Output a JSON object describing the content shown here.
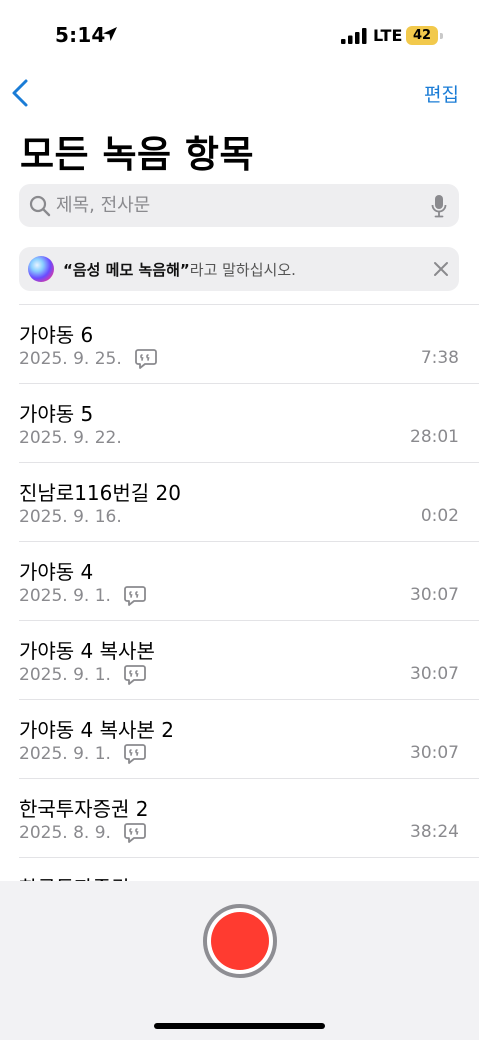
{
  "status_bar": {
    "time": "5:14",
    "carrier": "LTE",
    "battery": "42"
  },
  "nav": {
    "edit_label": "편집"
  },
  "page_title": "모든 녹음 항목",
  "search": {
    "placeholder": "제목, 전사문"
  },
  "siri_suggestion": {
    "quote": "“음성 메모 녹음해”",
    "text": "라고 말하십시오."
  },
  "recordings": [
    {
      "title": "가야동 6",
      "date": "2025. 9. 25.",
      "duration": "7:38",
      "has_transcript": true
    },
    {
      "title": "가야동 5",
      "date": "2025. 9. 22.",
      "duration": "28:01",
      "has_transcript": false
    },
    {
      "title": "진남로116번길 20",
      "date": "2025. 9. 16.",
      "duration": "0:02",
      "has_transcript": false
    },
    {
      "title": "가야동 4",
      "date": "2025. 9. 1.",
      "duration": "30:07",
      "has_transcript": true
    },
    {
      "title": "가야동 4 복사본",
      "date": "2025. 9. 1.",
      "duration": "30:07",
      "has_transcript": true
    },
    {
      "title": "가야동 4 복사본 2",
      "date": "2025. 9. 1.",
      "duration": "30:07",
      "has_transcript": true
    },
    {
      "title": "한국투자증권 2",
      "date": "2025. 8. 9.",
      "duration": "38:24",
      "has_transcript": true
    },
    {
      "title": "한국투자증권",
      "date": "",
      "duration": "",
      "has_transcript": false
    }
  ],
  "colors": {
    "accent": "#1a7cd6",
    "record": "#ff3b30",
    "secondary_text": "#8a8a8e"
  }
}
